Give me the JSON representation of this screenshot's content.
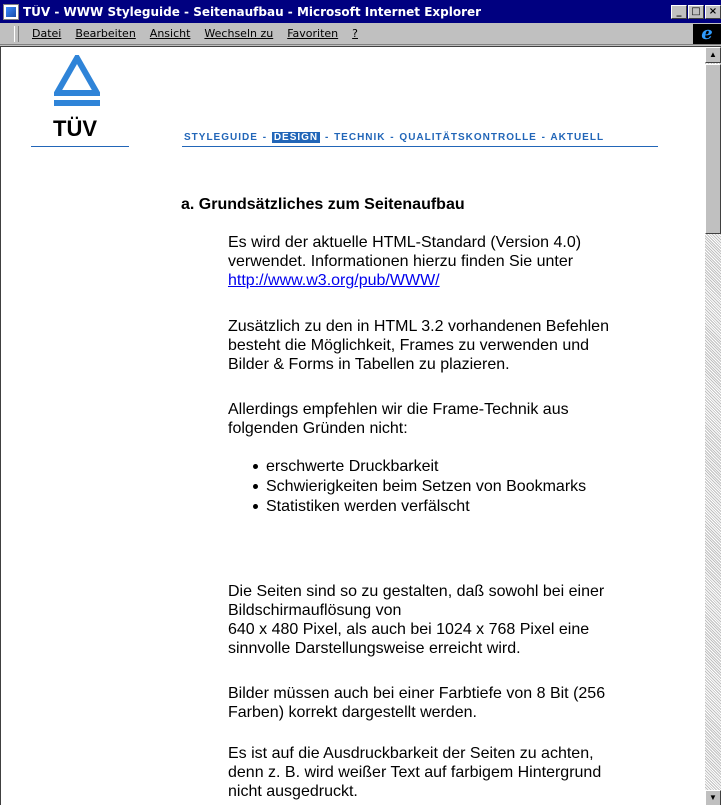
{
  "window": {
    "title": "TÜV - WWW Styleguide - Seitenaufbau - Microsoft Internet Explorer",
    "buttons": {
      "minimize": "_",
      "maximize": "□",
      "close": "×"
    }
  },
  "menubar": {
    "items": [
      "Datei",
      "Bearbeiten",
      "Ansicht",
      "Wechseln zu",
      "Favoriten",
      "?"
    ],
    "ie_logo": "e"
  },
  "logo": {
    "text": "TÜV",
    "color": "#2f84d8"
  },
  "nav": {
    "items": [
      "STYLEGUIDE",
      "DESIGN",
      "TECHNIK",
      "QUALITÄTSKONTROLLE",
      "AKTUELL"
    ],
    "separator": "-",
    "active": "DESIGN",
    "color": "#2266b8"
  },
  "content": {
    "heading": "a. Grundsätzliches zum Seitenaufbau",
    "p1": {
      "line1": "Es wird der aktuelle HTML-Standard (Version 4.0)",
      "line2": "verwendet. Informationen hierzu finden Sie unter",
      "link": "http://www.w3.org/pub/WWW/"
    },
    "p2": {
      "line1": "Zusätzlich zu den in HTML 3.2 vorhandenen Befehlen",
      "line2": "besteht die Möglichkeit, Frames zu verwenden und",
      "line3": "Bilder & Forms in Tabellen zu plazieren."
    },
    "p3": {
      "line1": "Allerdings empfehlen wir die Frame-Technik aus",
      "line2": "folgenden Gründen nicht:"
    },
    "bullets": [
      "erschwerte Druckbarkeit",
      "Schwierigkeiten beim Setzen von Bookmarks",
      "Statistiken werden verfälscht"
    ],
    "p4": {
      "line1": "Die Seiten sind so zu gestalten, daß sowohl bei einer",
      "line2": "Bildschirmauflösung von",
      "line3": "640 x 480 Pixel, als auch bei 1024 x 768 Pixel eine",
      "line4": "sinnvolle Darstellungsweise erreicht wird."
    },
    "p5": {
      "line1": "Bilder müssen auch bei einer Farbtiefe von 8 Bit (256",
      "line2": "Farben) korrekt dargestellt werden."
    },
    "p6": {
      "line1": "Es ist auf die Ausdruckbarkeit der Seiten zu achten,",
      "line2": "denn z. B. wird weißer Text auf farbigem Hintergrund",
      "line3": "nicht ausgedruckt."
    }
  },
  "scrollbar": {
    "up_arrow": "▲",
    "down_arrow": "▼"
  }
}
